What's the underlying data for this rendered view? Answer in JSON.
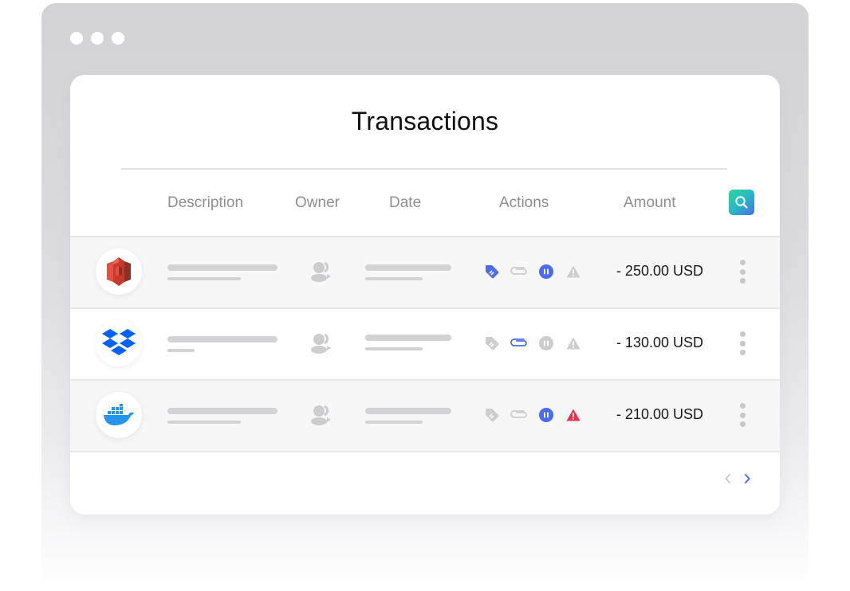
{
  "window": {
    "controls": [
      "dot",
      "dot",
      "dot"
    ]
  },
  "page": {
    "title": "Transactions"
  },
  "table": {
    "columns": {
      "description": "Description",
      "owner": "Owner",
      "date": "Date",
      "actions": "Actions",
      "amount": "Amount"
    },
    "search_icon": "search-icon",
    "rows": [
      {
        "logo": "aws-s3-logo",
        "amount": "- 250.00 USD",
        "actions": {
          "tag": "active",
          "attachment": "inactive",
          "pause": "active",
          "warning": "inactive"
        }
      },
      {
        "logo": "dropbox-logo",
        "amount": "- 130.00 USD",
        "actions": {
          "tag": "inactive",
          "attachment": "active",
          "pause": "inactive",
          "warning": "inactive"
        }
      },
      {
        "logo": "docker-logo",
        "amount": "- 210.00 USD",
        "actions": {
          "tag": "inactive",
          "attachment": "inactive",
          "pause": "active",
          "warning": "alert"
        }
      }
    ]
  },
  "pagination": {
    "prev_state": "disabled",
    "next_state": "enabled"
  },
  "colors": {
    "accent": "#4a6cf0",
    "inactive_icon": "#cdcdd0",
    "alert": "#f0304a",
    "search_gradient_start": "#2fd39a",
    "search_gradient_end": "#4a6cf0"
  }
}
